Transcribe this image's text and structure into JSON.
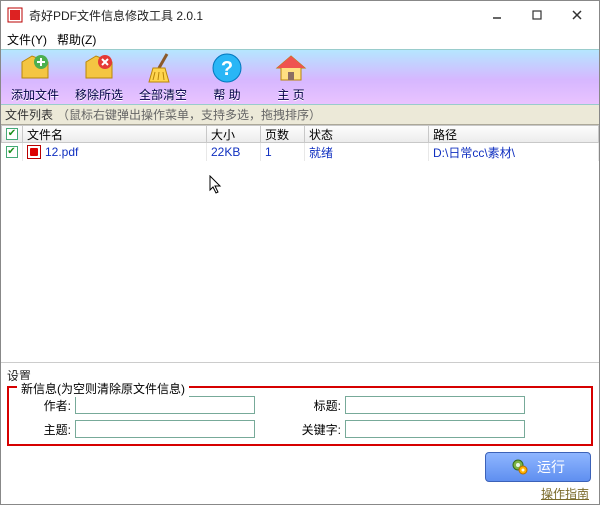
{
  "window": {
    "title": "奇好PDF文件信息修改工具  2.0.1"
  },
  "menu": {
    "file": "文件(Y)",
    "help": "帮助(Z)"
  },
  "toolbar": {
    "add": "添加文件",
    "remove": "移除所选",
    "clear": "全部清空",
    "helpbtn": "帮 助",
    "home": "主 页"
  },
  "listheader": {
    "title": "文件列表",
    "hint": "（鼠标右键弹出操作菜单，支持多选，拖拽排序）"
  },
  "columns": {
    "name": "文件名",
    "size": "大小",
    "pages": "页数",
    "status": "状态",
    "path": "路径"
  },
  "rows": [
    {
      "checked": true,
      "name": "12.pdf",
      "size": "22KB",
      "pages": "1",
      "status": "就绪",
      "path": "D:\\日常cc\\素材\\"
    }
  ],
  "settings_label": "设置",
  "fieldset_legend": "新信息(为空则清除原文件信息)",
  "fields": {
    "author_label": "作者:",
    "author_value": "",
    "title_label": "标题:",
    "title_value": "",
    "subject_label": "主题:",
    "subject_value": "",
    "keywords_label": "关键字:",
    "keywords_value": ""
  },
  "run_label": "运行",
  "guide_label": "操作指南"
}
